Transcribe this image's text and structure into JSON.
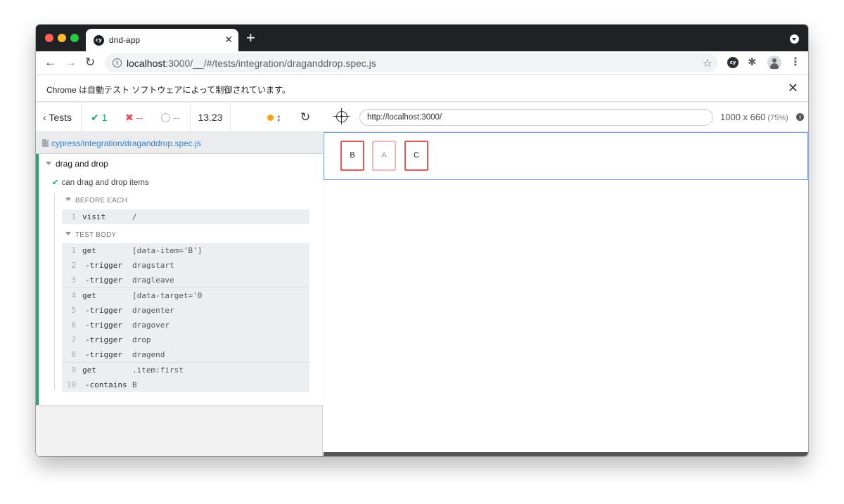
{
  "browser": {
    "tab_title": "dnd-app",
    "tab_favicon": "cy",
    "new_tab_icon": "+",
    "url_host": "localhost",
    "url_path": ":3000/__/#/tests/integration/draganddrop.spec.js",
    "ext_icon": "cy"
  },
  "infobar": {
    "message": "Chrome は自動テスト ソフトウェアによって制御されています。"
  },
  "reporter": {
    "tests_label": "Tests",
    "passed": "1",
    "failed": "--",
    "pending": "--",
    "duration": "13.23",
    "spec_path": "cypress/integration/draganddrop.spec.js",
    "suite_title": "drag and drop",
    "test_title": "can drag and drop items",
    "before_each_label": "BEFORE EACH",
    "test_body_label": "TEST BODY",
    "before_each_commands": [
      {
        "num": "1",
        "name": "visit",
        "msg": "/"
      }
    ],
    "test_body_commands": [
      {
        "num": "1",
        "name": "get",
        "msg": "[data-item='B']"
      },
      {
        "num": "2",
        "name": "-trigger",
        "msg": "dragstart"
      },
      {
        "num": "3",
        "name": "-trigger",
        "msg": "dragleave"
      },
      {
        "num": "4",
        "name": "get",
        "msg": "[data-target='0"
      },
      {
        "num": "5",
        "name": "-trigger",
        "msg": "dragenter"
      },
      {
        "num": "6",
        "name": "-trigger",
        "msg": "dragover"
      },
      {
        "num": "7",
        "name": "-trigger",
        "msg": "drop"
      },
      {
        "num": "8",
        "name": "-trigger",
        "msg": "dragend"
      },
      {
        "num": "9",
        "name": "get",
        "msg": ".item:first"
      },
      {
        "num": "10",
        "name": "-contains",
        "msg": "B"
      }
    ]
  },
  "aut": {
    "url": "http://localhost:3000/",
    "viewport": "1000 x 660",
    "scale": "(75%)",
    "items": [
      "B",
      "A",
      "C"
    ]
  },
  "colors": {
    "pass": "#1fa971",
    "fail": "#e94f5f",
    "running_dot": "#f7a30f",
    "item_border": "#e5585a",
    "link": "#3380d7"
  }
}
